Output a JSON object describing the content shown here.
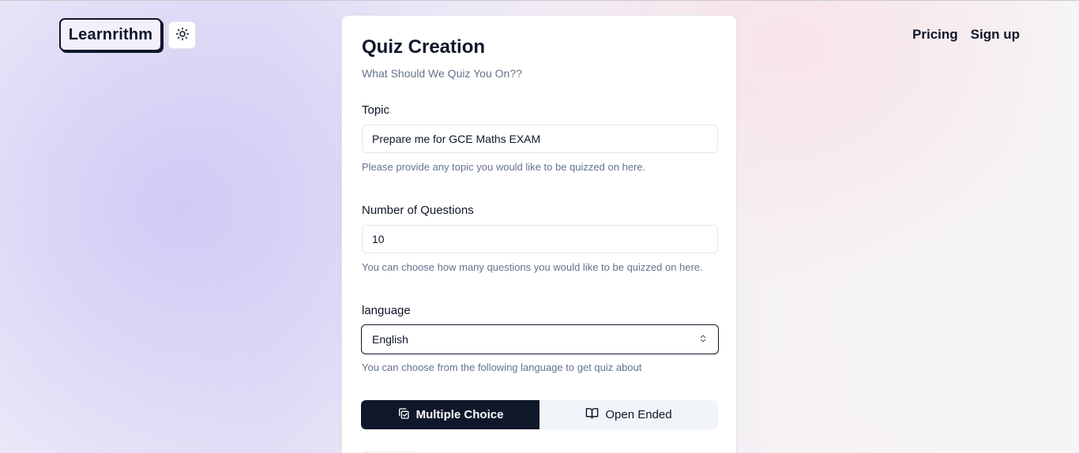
{
  "header": {
    "logo_text": "Learnrithm",
    "theme_icon": "sun-icon",
    "nav": [
      {
        "label": "Pricing"
      },
      {
        "label": "Sign up"
      }
    ]
  },
  "form": {
    "title": "Quiz Creation",
    "subtitle": "What Should We Quiz You On??",
    "topic": {
      "label": "Topic",
      "value": "Prepare me for GCE Maths EXAM",
      "help": "Please provide any topic you would like to be quizzed on here."
    },
    "questions": {
      "label": "Number of Questions",
      "value": "10",
      "help": "You can choose how many questions you would like to be quizzed on here."
    },
    "language": {
      "label": "language",
      "selected": "English",
      "help": "You can choose from the following language to get quiz about"
    },
    "type_toggle": {
      "options": [
        {
          "label": "Multiple Choice",
          "icon": "copy-check-icon",
          "active": true
        },
        {
          "label": "Open Ended",
          "icon": "book-open-icon",
          "active": false
        }
      ]
    }
  },
  "colors": {
    "primary": "#0f172a",
    "muted_text": "#64748b",
    "border": "#e2e8f0",
    "toggle_bg": "#f1f5f9"
  }
}
